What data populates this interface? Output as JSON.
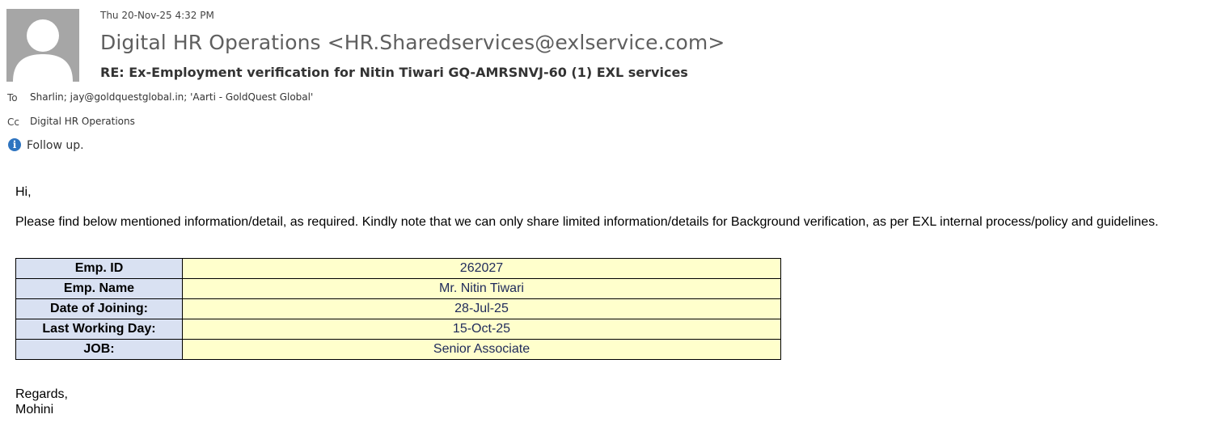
{
  "email": {
    "date": "Thu 20-Nov-25 4:32 PM",
    "sender": "Digital HR Operations <HR.Sharedservices@exlservice.com>",
    "subject": "RE: Ex-Employment verification for Nitin Tiwari GQ-AMRSNVJ-60 (1) EXL services",
    "to_label": "To",
    "to_value": "Sharlin; jay@goldquestglobal.in; 'Aarti - GoldQuest Global'",
    "cc_label": "Cc",
    "cc_value": "Digital HR Operations",
    "flag_text": "Follow up."
  },
  "body": {
    "greeting": "Hi,",
    "paragraph": "Please find below mentioned information/detail, as required. Kindly note that we can only share limited information/details for Background verification, as per EXL internal process/policy and guidelines.",
    "table": [
      {
        "label": "Emp. ID",
        "value": "262027"
      },
      {
        "label": "Emp. Name",
        "value": "Mr. Nitin Tiwari"
      },
      {
        "label": "Date of Joining:",
        "value": "28-Jul-25"
      },
      {
        "label": "Last Working Day:",
        "value": "15-Oct-25"
      },
      {
        "label": "JOB:",
        "value": "Senior Associate"
      }
    ],
    "closing": "Regards,",
    "signature": "Mohini"
  },
  "colors": {
    "label_cell_bg": "#d9e1f2",
    "value_cell_bg": "#ffffcc",
    "info_icon": "#2e74c0"
  }
}
